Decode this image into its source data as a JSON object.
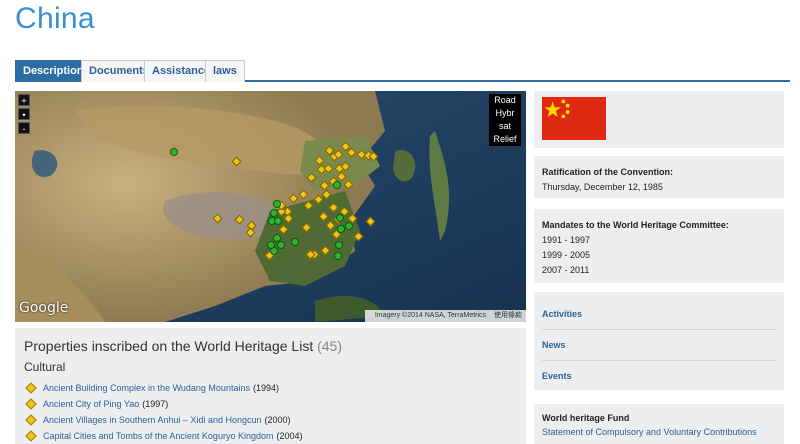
{
  "page": {
    "title": "China"
  },
  "tabs": [
    {
      "label": "Description",
      "active": true
    },
    {
      "label": "Documents",
      "active": false
    },
    {
      "label": "Assistance",
      "active": false
    },
    {
      "label": "laws",
      "active": false
    }
  ],
  "map": {
    "zoom_in": "+",
    "zoom_reset": "•",
    "zoom_out": "-",
    "types": [
      "Road",
      "Hybr",
      "sat",
      "Relief"
    ],
    "logo": "Google",
    "attribution": "Imagery ©2014 NASA, TerraMetrics",
    "terms": "使用條款"
  },
  "properties": {
    "heading": "Properties inscribed on the World Heritage List",
    "count": "(45)",
    "category": "Cultural",
    "items": [
      {
        "name": "Ancient Building Complex in the Wudang Mountains",
        "year": "(1994)"
      },
      {
        "name": "Ancient City of Ping Yao",
        "year": "(1997)"
      },
      {
        "name": "Ancient Villages in Southern Anhui – Xidi and Hongcun",
        "year": "(2000)"
      },
      {
        "name": "Capital Cities and Tombs of the Ancient Koguryo Kingdom",
        "year": "(2004)"
      }
    ]
  },
  "sidebar": {
    "flag_colors": {
      "field": "#de2910",
      "stars": "#ffde00"
    },
    "ratification": {
      "label": "Ratification of the Convention:",
      "value": "Thursday, December 12, 1985"
    },
    "mandates": {
      "label": "Mandates to the World Heritage Committee:",
      "values": [
        "1991 - 1997",
        "1999 - 2005",
        "2007 - 2011"
      ]
    },
    "links": [
      "Activities",
      "News",
      "Events"
    ],
    "fund": {
      "label": "World heritage Fund",
      "link": "Statement of Compulsory and Voluntary Contributions"
    }
  },
  "colors": {
    "accent": "#2e6da4",
    "title": "#3a8fd0",
    "link": "#2d5f96",
    "marker_cultural": "#f0c419",
    "marker_natural": "#2fb52f"
  }
}
